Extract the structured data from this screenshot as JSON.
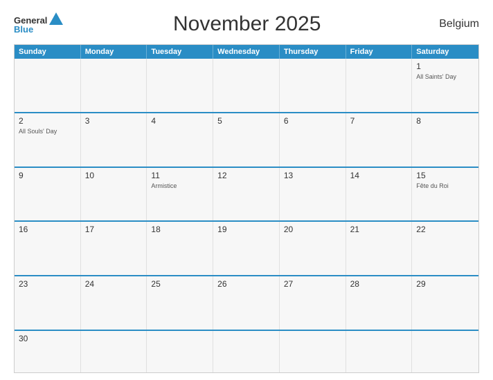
{
  "header": {
    "title": "November 2025",
    "country": "Belgium",
    "logo": {
      "general": "General",
      "blue": "Blue"
    }
  },
  "days_of_week": [
    "Sunday",
    "Monday",
    "Tuesday",
    "Wednesday",
    "Thursday",
    "Friday",
    "Saturday"
  ],
  "weeks": [
    [
      {
        "day": "",
        "holiday": ""
      },
      {
        "day": "",
        "holiday": ""
      },
      {
        "day": "",
        "holiday": ""
      },
      {
        "day": "",
        "holiday": ""
      },
      {
        "day": "",
        "holiday": ""
      },
      {
        "day": "",
        "holiday": ""
      },
      {
        "day": "1",
        "holiday": "All Saints' Day"
      }
    ],
    [
      {
        "day": "2",
        "holiday": "All Souls' Day"
      },
      {
        "day": "3",
        "holiday": ""
      },
      {
        "day": "4",
        "holiday": ""
      },
      {
        "day": "5",
        "holiday": ""
      },
      {
        "day": "6",
        "holiday": ""
      },
      {
        "day": "7",
        "holiday": ""
      },
      {
        "day": "8",
        "holiday": ""
      }
    ],
    [
      {
        "day": "9",
        "holiday": ""
      },
      {
        "day": "10",
        "holiday": ""
      },
      {
        "day": "11",
        "holiday": "Armistice"
      },
      {
        "day": "12",
        "holiday": ""
      },
      {
        "day": "13",
        "holiday": ""
      },
      {
        "day": "14",
        "holiday": ""
      },
      {
        "day": "15",
        "holiday": "Fête du Roi"
      }
    ],
    [
      {
        "day": "16",
        "holiday": ""
      },
      {
        "day": "17",
        "holiday": ""
      },
      {
        "day": "18",
        "holiday": ""
      },
      {
        "day": "19",
        "holiday": ""
      },
      {
        "day": "20",
        "holiday": ""
      },
      {
        "day": "21",
        "holiday": ""
      },
      {
        "day": "22",
        "holiday": ""
      }
    ],
    [
      {
        "day": "23",
        "holiday": ""
      },
      {
        "day": "24",
        "holiday": ""
      },
      {
        "day": "25",
        "holiday": ""
      },
      {
        "day": "26",
        "holiday": ""
      },
      {
        "day": "27",
        "holiday": ""
      },
      {
        "day": "28",
        "holiday": ""
      },
      {
        "day": "29",
        "holiday": ""
      }
    ],
    [
      {
        "day": "30",
        "holiday": ""
      },
      {
        "day": "",
        "holiday": ""
      },
      {
        "day": "",
        "holiday": ""
      },
      {
        "day": "",
        "holiday": ""
      },
      {
        "day": "",
        "holiday": ""
      },
      {
        "day": "",
        "holiday": ""
      },
      {
        "day": "",
        "holiday": ""
      }
    ]
  ]
}
